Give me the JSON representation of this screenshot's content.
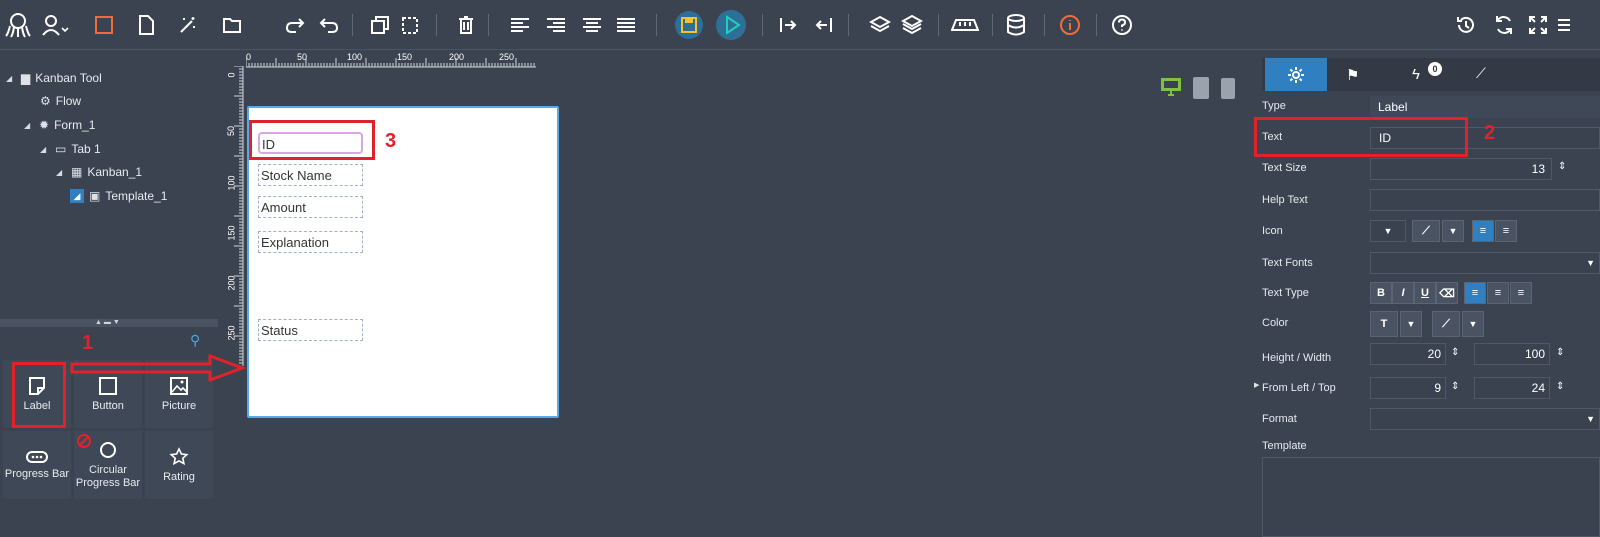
{
  "toolbar": {
    "icons": [
      "octopus-logo",
      "user-icon",
      "rectangle-icon",
      "file-icon",
      "magic-wand-icon",
      "folder-icon",
      "redo-icon",
      "undo-icon",
      "copy-icon",
      "paste-icon",
      "trash-icon",
      "align-left-icon",
      "align-right-icon",
      "align-center-icon",
      "align-justify-icon",
      "save-icon",
      "play-icon",
      "indent-right-icon",
      "indent-left-icon",
      "layers-icon",
      "layers-alt-icon",
      "ruler-icon",
      "database-icon",
      "info-icon",
      "help-icon",
      "history-icon",
      "refresh-icon",
      "fullscreen-icon",
      "menu-icon"
    ]
  },
  "tree": {
    "items": [
      {
        "label": "Kanban Tool"
      },
      {
        "label": "Flow"
      },
      {
        "label": "Form_1"
      },
      {
        "label": "Tab 1"
      },
      {
        "label": "Kanban_1"
      },
      {
        "label": "Template_1"
      }
    ]
  },
  "components": [
    {
      "label": "Label",
      "icon": "label-icon"
    },
    {
      "label": "Button",
      "icon": "button-icon"
    },
    {
      "label": "Picture",
      "icon": "picture-icon"
    },
    {
      "label": "Progress Bar",
      "icon": "progress-bar-icon"
    },
    {
      "label": "Circular Progress Bar",
      "icon": "circular-progress-icon"
    },
    {
      "label": "Rating",
      "icon": "star-icon"
    }
  ],
  "ruler": {
    "h_ticks": [
      "0",
      "50",
      "100",
      "150",
      "200",
      "250"
    ],
    "v_ticks": [
      "0",
      "50",
      "100",
      "150",
      "200",
      "250"
    ]
  },
  "form": {
    "fields": [
      {
        "label": "ID"
      },
      {
        "label": "Stock Name"
      },
      {
        "label": "Amount"
      },
      {
        "label": "Explanation"
      },
      {
        "label": "Status"
      }
    ]
  },
  "annotations": {
    "step1": "1",
    "step2": "2",
    "step3": "3",
    "color": "#e3212b"
  },
  "properties": {
    "tabs": [
      {
        "icon": "gear-icon"
      },
      {
        "icon": "flag-icon"
      },
      {
        "icon": "lightning-icon",
        "badge": "0"
      },
      {
        "icon": "brush-icon"
      }
    ],
    "type_label": "Type",
    "type_value": "Label",
    "text_label": "Text",
    "text_value": "ID",
    "text_size_label": "Text Size",
    "text_size_value": "13",
    "help_text_label": "Help Text",
    "icon_label": "Icon",
    "text_fonts_label": "Text Fonts",
    "text_type_label": "Text Type",
    "color_label": "Color",
    "hw_label": "Height / Width",
    "height_value": "20",
    "width_value": "100",
    "flt_label": "From Left / Top",
    "left_value": "9",
    "top_value": "24",
    "format_label": "Format",
    "template_label": "Template"
  },
  "colors": {
    "background": "#3b4350",
    "accent": "#2f7fc1",
    "save": "#f2c230",
    "play": "#1fb0a0",
    "annotation": "#e3212b",
    "device_active": "#7dc243"
  }
}
